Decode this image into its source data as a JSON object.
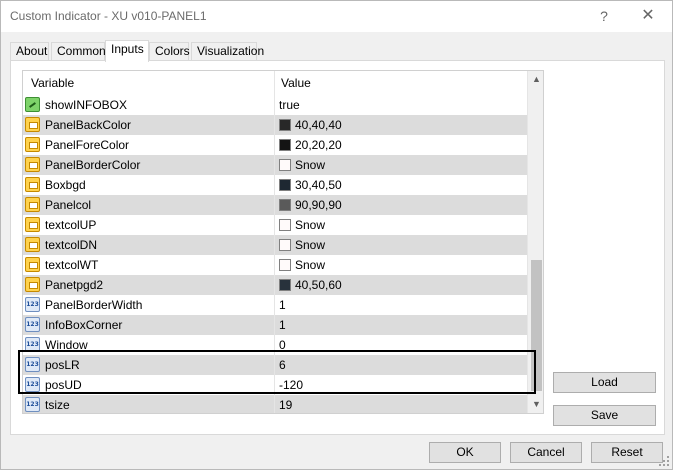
{
  "window": {
    "title": "Custom Indicator - XU v010-PANEL1",
    "help_label": "?",
    "close_label": "✕"
  },
  "tabs": [
    {
      "label": "About"
    },
    {
      "label": "Common"
    },
    {
      "label": "Inputs",
      "active": true
    },
    {
      "label": "Colors"
    },
    {
      "label": "Visualization"
    }
  ],
  "grid": {
    "columns": {
      "variable": "Variable",
      "value": "Value"
    },
    "rows": [
      {
        "icon": "bool-icon",
        "name": "showINFOBOX",
        "value": "true"
      },
      {
        "icon": "color-icon",
        "name": "PanelBackColor",
        "value": "40,40,40",
        "swatch": "#282828"
      },
      {
        "icon": "color-icon",
        "name": "PanelForeColor",
        "value": "20,20,20",
        "swatch": "#141414"
      },
      {
        "icon": "color-icon",
        "name": "PanelBorderColor",
        "value": "Snow",
        "swatch": "#fffafa"
      },
      {
        "icon": "color-icon",
        "name": "Boxbgd",
        "value": "30,40,50",
        "swatch": "#1e2832"
      },
      {
        "icon": "color-icon",
        "name": "Panelcol",
        "value": "90,90,90",
        "swatch": "#5a5a5a"
      },
      {
        "icon": "color-icon",
        "name": "textcolUP",
        "value": "Snow",
        "swatch": "#fffafa"
      },
      {
        "icon": "color-icon",
        "name": "textcolDN",
        "value": "Snow",
        "swatch": "#fffafa"
      },
      {
        "icon": "color-icon",
        "name": "textcolWT",
        "value": "Snow",
        "swatch": "#fffafa"
      },
      {
        "icon": "color-icon",
        "name": "Panetpgd2",
        "value": "40,50,60",
        "swatch": "#28323c"
      },
      {
        "icon": "number-icon",
        "name": "PanelBorderWidth",
        "value": "1"
      },
      {
        "icon": "number-icon",
        "name": "InfoBoxCorner",
        "value": "1"
      },
      {
        "icon": "number-icon",
        "name": "Window",
        "value": "0"
      },
      {
        "icon": "number-icon",
        "name": "posLR",
        "value": "6"
      },
      {
        "icon": "number-icon",
        "name": "posUD",
        "value": "-120"
      },
      {
        "icon": "number-icon",
        "name": "tsize",
        "value": "19"
      }
    ]
  },
  "buttons": {
    "load": "Load",
    "save": "Save",
    "ok": "OK",
    "cancel": "Cancel",
    "reset": "Reset"
  }
}
